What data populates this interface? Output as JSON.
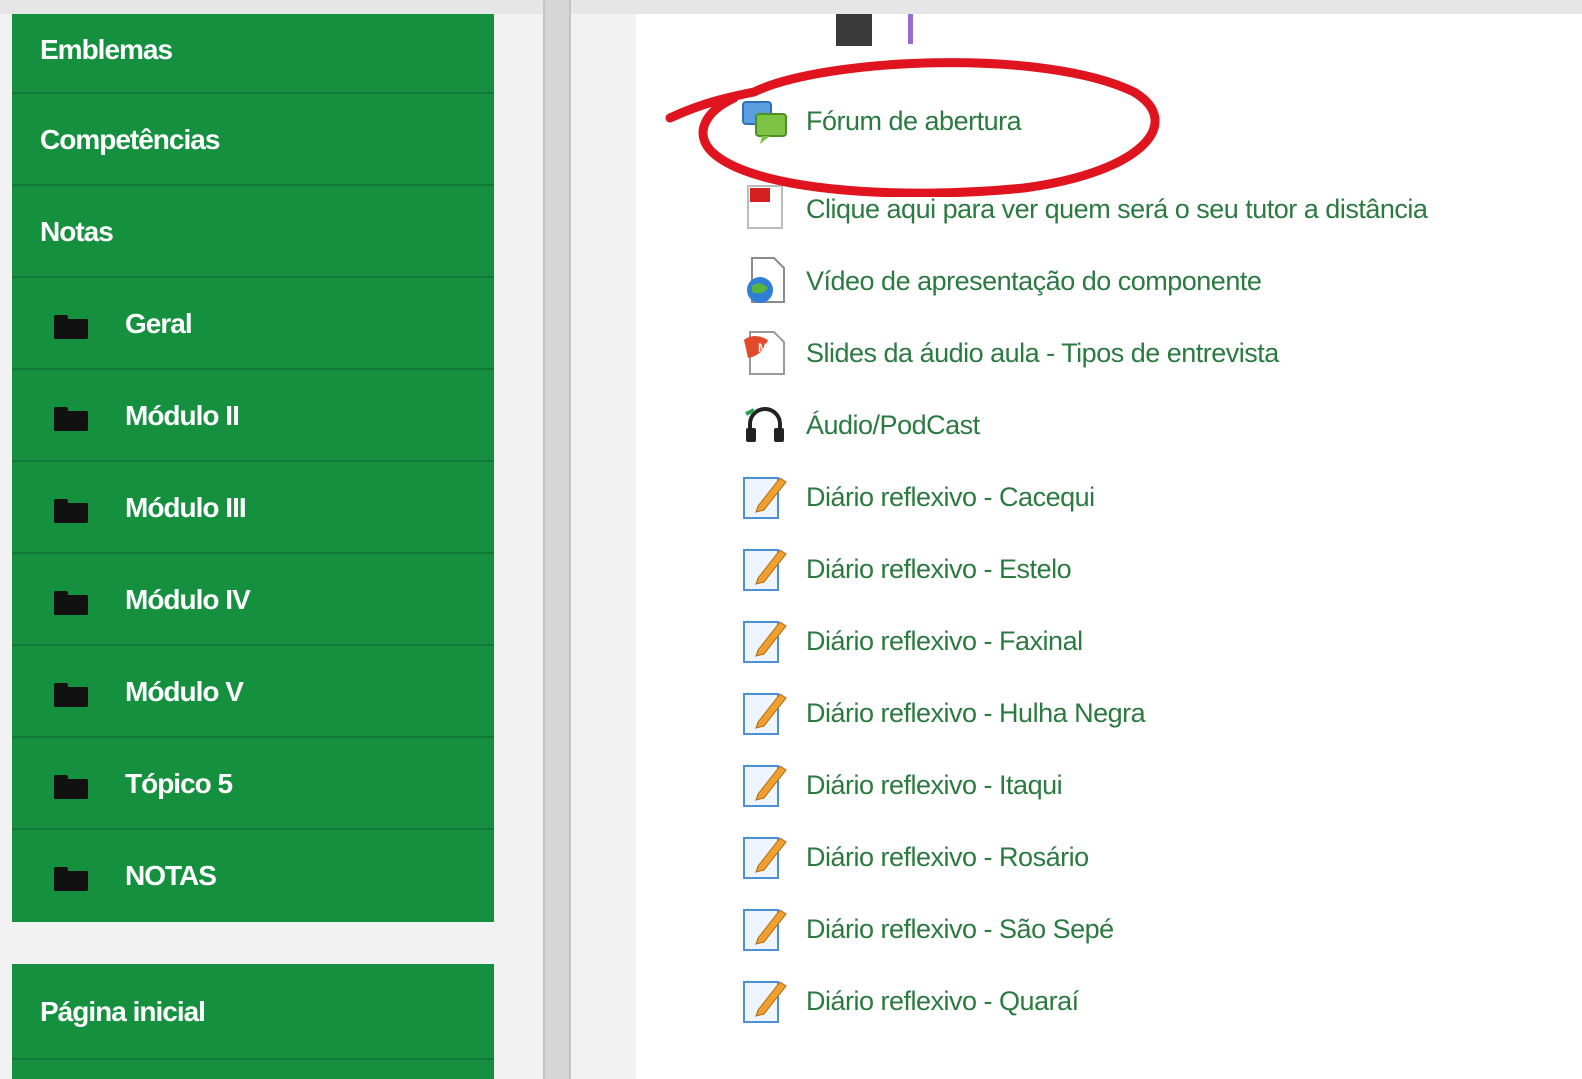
{
  "sidebar": {
    "items": [
      {
        "label": "Emblemas"
      },
      {
        "label": "Competências"
      },
      {
        "label": "Notas"
      },
      {
        "label": "Geral"
      },
      {
        "label": "Módulo II"
      },
      {
        "label": "Módulo III"
      },
      {
        "label": "Módulo IV"
      },
      {
        "label": "Módulo V"
      },
      {
        "label": "Tópico 5"
      },
      {
        "label": "NOTAS"
      }
    ],
    "home": {
      "label": "Página inicial"
    }
  },
  "activities": [
    {
      "label": "Fórum de abertura",
      "icon": "forum-icon"
    },
    {
      "label": "Clique aqui para ver quem será o seu tutor a distância",
      "icon": "pdf-icon"
    },
    {
      "label": "Vídeo de apresentação do componente",
      "icon": "video-icon"
    },
    {
      "label": "Slides da áudio aula - Tipos de entrevista",
      "icon": "slides-icon"
    },
    {
      "label": "Áudio/PodCast",
      "icon": "audio-icon"
    },
    {
      "label": "Diário reflexivo - Cacequi",
      "icon": "journal-icon"
    },
    {
      "label": "Diário reflexivo - Estelo",
      "icon": "journal-icon"
    },
    {
      "label": "Diário reflexivo - Faxinal",
      "icon": "journal-icon"
    },
    {
      "label": "Diário reflexivo - Hulha Negra",
      "icon": "journal-icon"
    },
    {
      "label": "Diário reflexivo - Itaqui",
      "icon": "journal-icon"
    },
    {
      "label": "Diário reflexivo - Rosário",
      "icon": "journal-icon"
    },
    {
      "label": "Diário reflexivo - São Sepé",
      "icon": "journal-icon"
    },
    {
      "label": "Diário reflexivo - Quaraí",
      "icon": "journal-icon"
    }
  ],
  "colors": {
    "sidebar_green": "#14903f",
    "link_green": "#2b7a40",
    "highlight_red": "#e0141e"
  }
}
